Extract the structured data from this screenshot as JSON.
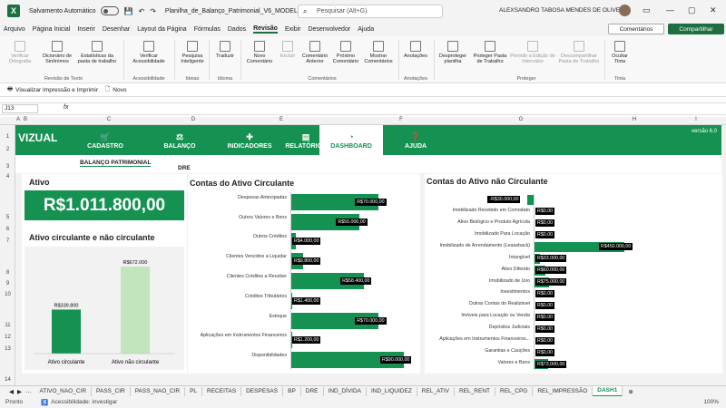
{
  "titlebar": {
    "autosave": "Salvamento Automático",
    "filename": "Planilha_de_Balanço_Patrimonial_V6_MODELO_NOVA.xlsx",
    "search_placeholder": "Pesquisar (Alt+G)",
    "user": "ALEXSANDRO TABOSA MENDES DE OLIVEIRA"
  },
  "menu": [
    "Arquivo",
    "Página Inicial",
    "Inserir",
    "Desenhar",
    "Layout da Página",
    "Fórmulas",
    "Dados",
    "Revisão",
    "Exibir",
    "Desenvolvedor",
    "Ajuda"
  ],
  "menu_active": "Revisão",
  "comments_btn": "Comentários",
  "share_btn": "Compartilhar",
  "ribbon": {
    "b1": "Verificar Ortografia",
    "b2": "Dicionário de Sinônimos",
    "b3": "Estatísticas da pasta de trabalho",
    "b4": "Verificar Acessibilidade",
    "b5": "Pesquisa Inteligente",
    "b6": "Traduzir",
    "b7": "Novo Comentário",
    "b8": "Excluir",
    "b9": "Comentário Anterior",
    "b10": "Próximo Comentário",
    "b11": "Mostrar Comentários",
    "b12": "Anotações",
    "b13": "Desproteger planilha",
    "b14": "Proteger Pasta de Trabalho",
    "b15": "Permitir a Edição de Intervalos",
    "b16": "Descompartilhar Pasta de Trabalho",
    "b17": "Ocultar Tinta",
    "g1": "Revisão de Texto",
    "g2": "Acessibilidade",
    "g3": "Ideias",
    "g4": "Idioma",
    "g5": "Comentários",
    "g6": "Anotações",
    "g7": "Proteger",
    "g8": "Tinta"
  },
  "qat": {
    "print": "Visualizar Impressão e Imprimir",
    "new": "Novo"
  },
  "namebox": "J13",
  "fx": "fx",
  "cols": [
    "A",
    "B",
    "C",
    "D",
    "E",
    "F",
    "G",
    "H",
    "I"
  ],
  "rows": [
    "1",
    "2",
    "3",
    "4",
    "5",
    "6",
    "7",
    "8",
    "9",
    "10",
    "11",
    "12",
    "13",
    "14"
  ],
  "dashboard": {
    "logo": "VIZUAL",
    "version": "versão 6.0",
    "nav": [
      {
        "icon": "🛒",
        "label": "CADASTRO"
      },
      {
        "icon": "⚖",
        "label": "BALANÇO"
      },
      {
        "icon": "✚",
        "label": "INDICADORES"
      },
      {
        "icon": "▤",
        "label": "RELATÓRIOS"
      },
      {
        "icon": "◔",
        "label": "DASHBOARD"
      },
      {
        "icon": "❓",
        "label": "AJUDA"
      }
    ],
    "subtabs": [
      "BALANÇO PATRIMONIAL",
      "DRE"
    ],
    "ativo_title": "Ativo",
    "ativo_value": "R$1.011.800,00",
    "circ_title": "Ativo circulante e não circulante",
    "circ_chart": {
      "labels": [
        "Ativo circulante",
        "Ativo não circulante"
      ],
      "values": [
        339800,
        672000
      ],
      "value_labels": [
        "R$339.800",
        "R$672.000"
      ]
    },
    "ac_title": "Contas do Ativo Circulante",
    "ac_chart": {
      "labels": [
        "Despesas Antecipadas",
        "Outros Valores e Bens",
        "Outros Créditos",
        "Clientes Vencidos a Liquidar",
        "Clientes Créditos a Receber",
        "Créditos Tributários",
        "Estoque",
        "Aplicações em Instrumentos Financeiros",
        "Disponibilidades"
      ],
      "values": [
        70000,
        55000,
        4000,
        9800,
        58400,
        1400,
        70000,
        1200,
        90000
      ],
      "value_labels": [
        "R$70.000,00",
        "R$55.000,00",
        "R$4.000,00",
        "R$9.800,00",
        "R$58.400,00",
        "R$1.400,00",
        "R$70.000,00",
        "R$1.200,00",
        "R$90.000,00"
      ]
    },
    "anc_title": "Contas do Ativo não Circulante",
    "anc_chart": {
      "labels": [
        "",
        "Imobilizado Recebido em Comodato",
        "Ativo Biológico e Produto Agrícola",
        "Imobilizado Para Locação",
        "Imobilizado de Arrendamento (Leaseback)",
        "Intangível",
        "Ativo Diferido",
        "Imobilizado de Uso",
        "Investimentos",
        "Outras Contas do Realizável",
        "Imóveis para Locação ou Venda",
        "Depósitos Judiciais",
        "Aplicações em Instrumentos Financeiros...",
        "Garantias e Cauções",
        "Valores e Bens"
      ],
      "values": [
        -30000,
        0,
        0,
        0,
        450000,
        33000,
        60000,
        75000,
        0,
        0,
        0,
        0,
        0,
        0,
        73000
      ],
      "value_labels": [
        "-R$30.000,00",
        "R$0,00",
        "R$0,00",
        "R$0,00",
        "R$450.000,00",
        "R$33.000,00",
        "R$60.000,00",
        "R$75.000,00",
        "R$0,00",
        "R$0,00",
        "R$0,00",
        "R$0,00",
        "R$0,00",
        "R$0,00",
        "R$73.000,00"
      ]
    }
  },
  "tabs": [
    "ATIVO_NAO_CIR",
    "PASS_CIR",
    "PASS_NAO_CIR",
    "PL",
    "RECEITAS",
    "DESPESAS",
    "BP",
    "DRE",
    "IND_DÍVIDA",
    "IND_LIQUIDEZ",
    "REL_ATIV",
    "REL_RENT",
    "REL_CPG",
    "REL_IMPRESSÃO",
    "DASH1"
  ],
  "tab_active": "DASH1",
  "status": {
    "ready": "Pronto",
    "accessibility": "Acessibilidade: investigar",
    "zoom": "100%"
  },
  "colors": {
    "brand": "#159251",
    "light_bar": "#c2e5bd"
  }
}
